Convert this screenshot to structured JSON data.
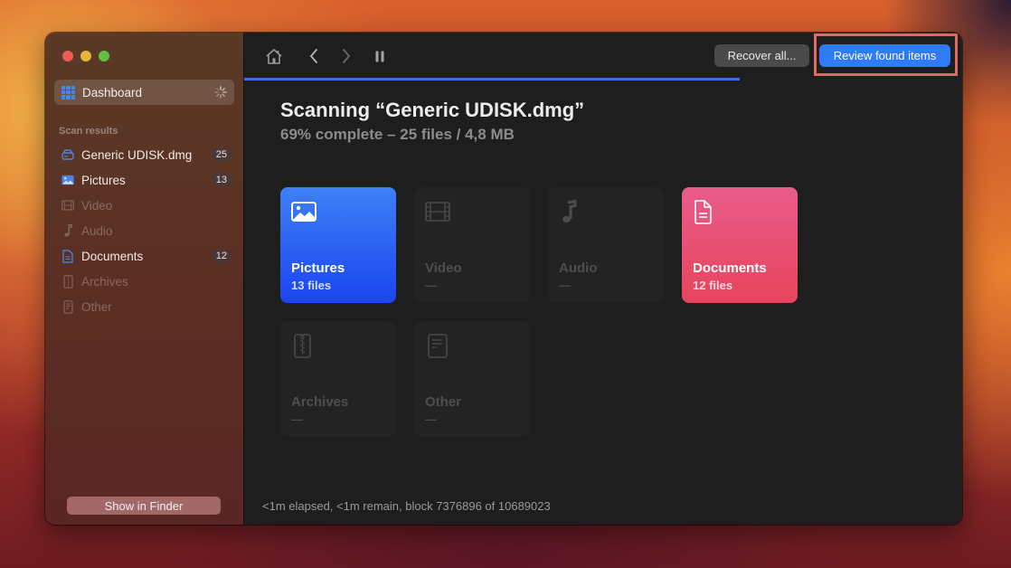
{
  "window": {
    "traffic_lights": [
      "close",
      "minimize",
      "zoom"
    ]
  },
  "sidebar": {
    "dashboard": {
      "label": "Dashboard",
      "icon": "grid-icon",
      "loading": true
    },
    "section_label": "Scan results",
    "items": [
      {
        "label": "Generic UDISK.dmg",
        "icon": "disk-icon",
        "badge": "25",
        "dim": false
      },
      {
        "label": "Pictures",
        "icon": "image-icon",
        "badge": "13",
        "dim": false
      },
      {
        "label": "Video",
        "icon": "film-icon",
        "badge": null,
        "dim": true
      },
      {
        "label": "Audio",
        "icon": "music-note-icon",
        "badge": null,
        "dim": true
      },
      {
        "label": "Documents",
        "icon": "document-icon",
        "badge": "12",
        "dim": false
      },
      {
        "label": "Archives",
        "icon": "zip-icon",
        "badge": null,
        "dim": true
      },
      {
        "label": "Other",
        "icon": "file-icon",
        "badge": null,
        "dim": true
      }
    ],
    "show_in_finder": "Show in Finder"
  },
  "toolbar": {
    "icons": [
      "home-icon",
      "back-icon",
      "forward-icon",
      "pause-icon"
    ],
    "recover_all": "Recover all...",
    "review_found_items": "Review found items",
    "progress_percent": 69
  },
  "main": {
    "title": "Scanning “Generic UDISK.dmg”",
    "subtitle": "69% complete – 25 files / 4,8 MB",
    "cards": [
      {
        "name": "Pictures",
        "count": "13 files",
        "icon": "image-icon",
        "active": true
      },
      {
        "name": "Video",
        "count": "—",
        "icon": "film-icon",
        "active": false
      },
      {
        "name": "Audio",
        "count": "—",
        "icon": "music-note-icon",
        "active": false
      },
      {
        "name": "Documents",
        "count": "12 files",
        "icon": "document-icon",
        "active": true
      },
      {
        "name": "Archives",
        "count": "—",
        "icon": "zip-icon",
        "active": false
      },
      {
        "name": "Other",
        "count": "—",
        "icon": "file-icon",
        "active": false
      }
    ],
    "status": "<1m elapsed, <1m remain, block 7376896 of 10689023"
  },
  "colors": {
    "accent": "#2f7bf6",
    "pictures_card": "#2a5ff3",
    "documents_card": "#e8506f",
    "highlight_border": "#e06a5f"
  }
}
